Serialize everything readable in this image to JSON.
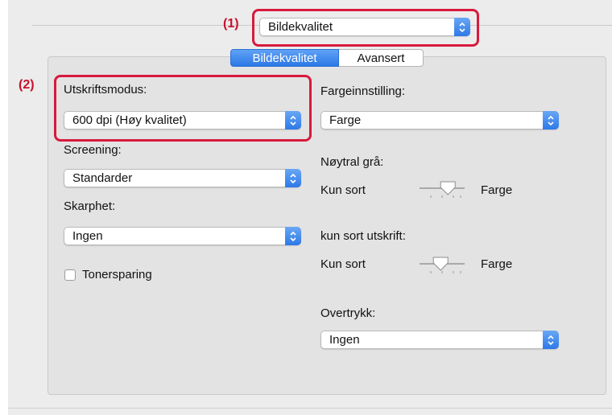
{
  "preset_popup": {
    "value": "Bildekvalitet",
    "callout": "(1)"
  },
  "tabs": [
    {
      "label": "Bildekvalitet",
      "selected": true
    },
    {
      "label": "Avansert",
      "selected": false
    }
  ],
  "left": {
    "callout": "(2)",
    "print_mode": {
      "label": "Utskriftsmodus:",
      "value": "600 dpi (Høy kvalitet)"
    },
    "screening": {
      "label": "Screening:",
      "value": "Standarder"
    },
    "sharpness": {
      "label": "Skarphet:",
      "value": "Ingen"
    },
    "toner_save": {
      "label": "Tonersparing",
      "checked": false
    }
  },
  "right": {
    "color_setting": {
      "label": "Fargeinnstilling:",
      "value": "Farge"
    },
    "neutral_gray": {
      "label": "Nøytral grå:",
      "min_label": "Kun sort",
      "max_label": "Farge",
      "level": 0.7
    },
    "black_only": {
      "label": "kun sort utskrift:",
      "min_label": "Kun sort",
      "max_label": "Farge",
      "level": 0.45
    },
    "overprint": {
      "label": "Overtrykk:",
      "value": "Ingen"
    }
  },
  "colors": {
    "accent": "#2e79e8",
    "callout": "#d81a3d"
  },
  "icons": {
    "popup_stepper": "up-down-chevron-icon",
    "slider_thumb": "triangle-slider-thumb-icon"
  }
}
